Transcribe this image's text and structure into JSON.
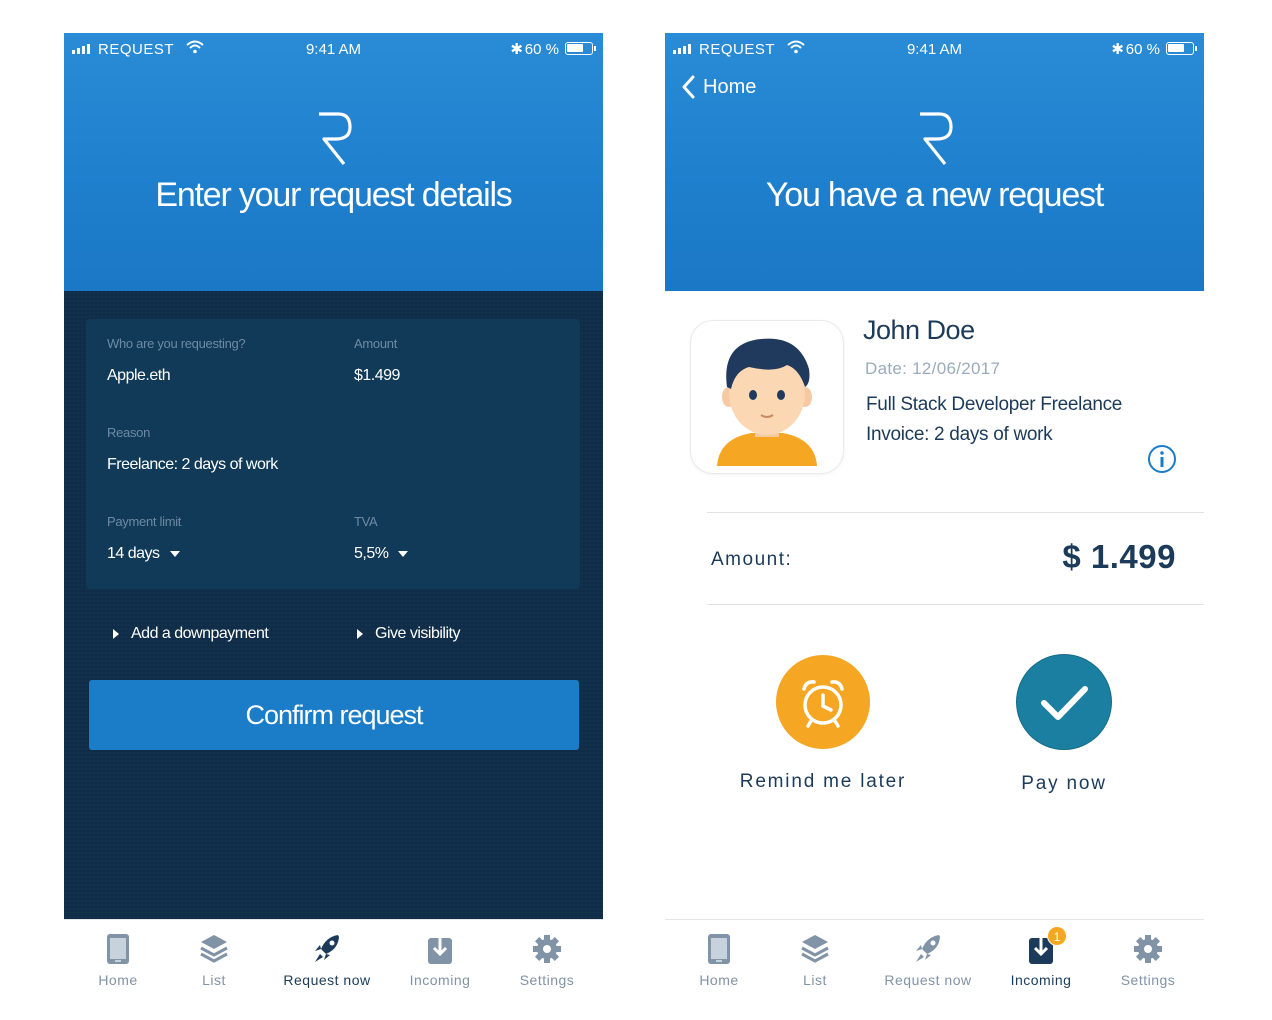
{
  "status_bar": {
    "carrier": "REQUEST",
    "time": "9:41 AM",
    "battery": "60 %"
  },
  "left_screen": {
    "header_title": "Enter your request details",
    "form": {
      "who_label": "Who are you requesting?",
      "who_value": "Apple.eth",
      "amount_label": "Amount",
      "amount_value": "$1.499",
      "reason_label": "Reason",
      "reason_value": "Freelance: 2 days of work",
      "payment_limit_label": "Payment limit",
      "payment_limit_value": "14 days",
      "tva_label": "TVA",
      "tva_value": "5,5%"
    },
    "options": {
      "downpayment": "Add a downpayment",
      "visibility": "Give visibility"
    },
    "confirm_button": "Confirm request",
    "active_tab": "Request now"
  },
  "right_screen": {
    "back_label": "Home",
    "header_title": "You have a new request",
    "requester": {
      "name": "John Doe",
      "date": "Date: 12/06/2017",
      "line1": "Full Stack Developer Freelance",
      "line2": "Invoice: 2 days of work"
    },
    "amount_label": "Amount:",
    "amount_value": "$ 1.499",
    "remind_label": "Remind me later",
    "pay_label": "Pay now",
    "active_tab": "Incoming",
    "incoming_badge": "1"
  },
  "tabs": {
    "home": "Home",
    "list": "List",
    "request_now": "Request now",
    "incoming": "Incoming",
    "settings": "Settings"
  },
  "colors": {
    "header_blue": "#1e7fcd",
    "dark_navy": "#0f2d48",
    "card_navy": "#103a58",
    "button_blue": "#1b7cc8",
    "remind_orange": "#f5a623",
    "pay_teal": "#1a7fa0",
    "text_navy": "#1c3b5a",
    "tab_gray": "#8193a6"
  },
  "icons": {
    "tab_home": "phone-icon",
    "tab_list": "layers-icon",
    "tab_request": "rocket-icon",
    "tab_incoming": "download-icon",
    "tab_settings": "gear-icon",
    "remind": "alarm-clock-icon",
    "pay": "checkmark-icon",
    "info": "info-icon",
    "back": "chevron-left-icon"
  }
}
